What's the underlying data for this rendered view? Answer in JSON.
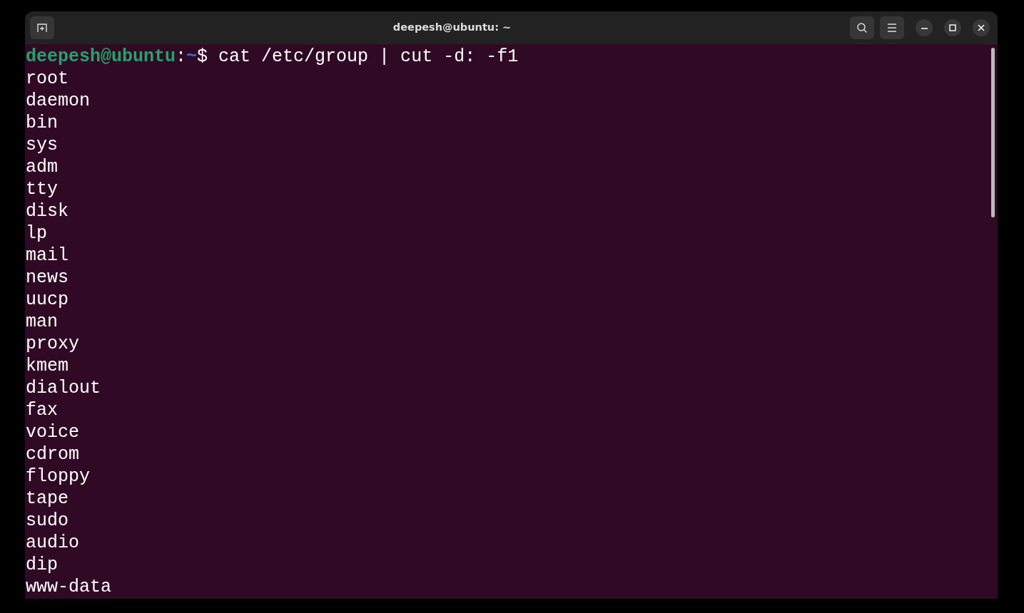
{
  "window": {
    "title": "deepesh@ubuntu: ~"
  },
  "prompt": {
    "user_host": "deepesh@ubuntu",
    "separator": ":",
    "path": "~",
    "symbol": "$",
    "command": "cat /etc/group | cut -d: -f1"
  },
  "output": [
    "root",
    "daemon",
    "bin",
    "sys",
    "adm",
    "tty",
    "disk",
    "lp",
    "mail",
    "news",
    "uucp",
    "man",
    "proxy",
    "kmem",
    "dialout",
    "fax",
    "voice",
    "cdrom",
    "floppy",
    "tape",
    "sudo",
    "audio",
    "dip",
    "www-data"
  ]
}
